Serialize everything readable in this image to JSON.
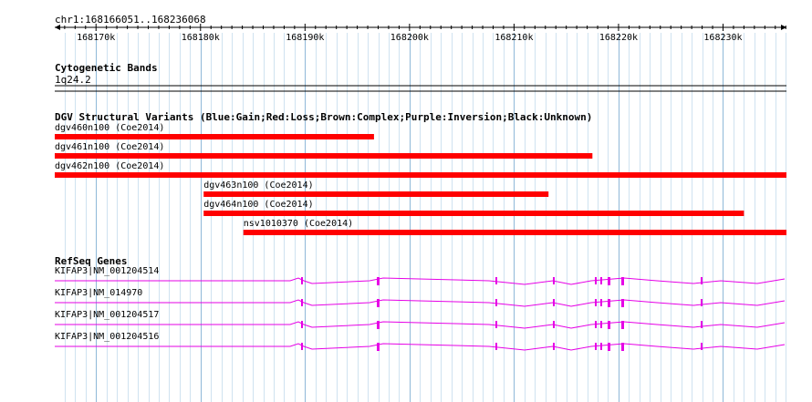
{
  "ruler": {
    "location": "chr1:168166051..168236068",
    "ticks": [
      "168170k",
      "168180k",
      "168190k",
      "168200k",
      "168210k",
      "168220k",
      "168230k"
    ]
  },
  "cytobands": {
    "title": "Cytogenetic Bands",
    "band": "1q24.2"
  },
  "dgv": {
    "title": "DGV Structural Variants (Blue:Gain;Red:Loss;Brown:Complex;Purple:Inversion;Black:Unknown)",
    "color": "#ff0000",
    "variants": [
      {
        "label": "dgv460n100 (Coe2014)",
        "start": 168166051,
        "end": 168196600
      },
      {
        "label": "dgv461n100 (Coe2014)",
        "start": 168166051,
        "end": 168217500
      },
      {
        "label": "dgv462n100 (Coe2014)",
        "start": 168166051,
        "end": 168236068
      },
      {
        "label": "dgv463n100 (Coe2014)",
        "start": 168180300,
        "end": 168213300
      },
      {
        "label": "dgv464n100 (Coe2014)",
        "start": 168180300,
        "end": 168232000
      },
      {
        "label": "nsv1010370 (Coe2014)",
        "start": 168184100,
        "end": 168236068
      }
    ]
  },
  "refseq": {
    "title": "RefSeq Genes",
    "color": "#e600e6",
    "transcripts": [
      {
        "label": "KIFAP3|NM_001204514"
      },
      {
        "label": "KIFAP3|NM_014970"
      },
      {
        "label": "KIFAP3|NM_001204517"
      },
      {
        "label": "KIFAP3|NM_001204516"
      }
    ]
  }
}
